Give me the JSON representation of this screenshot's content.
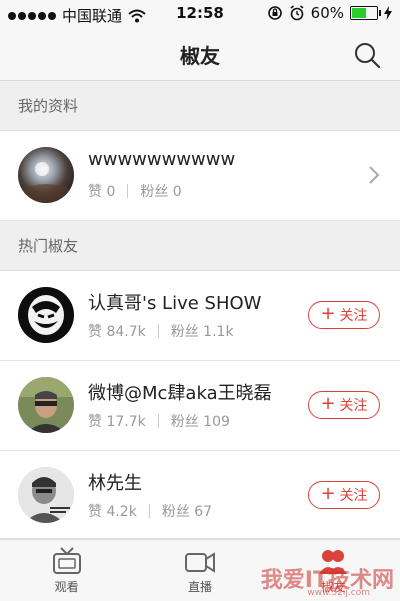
{
  "status_bar": {
    "carrier": "中国联通",
    "time": "12:58",
    "battery_percent": "60%",
    "battery_level": 0.6,
    "signal_bars": 5
  },
  "nav": {
    "title": "椒友",
    "search_icon": "search-icon"
  },
  "my_profile": {
    "section_title": "我的资料",
    "name": "wwwwwwwwww",
    "likes": "赞 0",
    "fans": "粉丝 0"
  },
  "hot_friends": {
    "section_title": "热门椒友",
    "follow_label": "关注",
    "items": [
      {
        "name": "认真哥's Live SHOW",
        "likes": "赞 84.7k",
        "fans": "粉丝 1.1k"
      },
      {
        "name": "微博@Mc肆aka王晓磊",
        "likes": "赞 17.7k",
        "fans": "粉丝 109"
      },
      {
        "name": "林先生",
        "likes": "赞 4.2k",
        "fans": "粉丝 67"
      }
    ]
  },
  "tabs": [
    {
      "label": "观看",
      "icon": "tv-icon"
    },
    {
      "label": "直播",
      "icon": "camera-icon"
    },
    {
      "label": "椒友",
      "icon": "friends-icon",
      "active": true
    }
  ],
  "watermark": {
    "text": "我爱IT技术网",
    "url": "www.52ij.com"
  },
  "colors": {
    "accent": "#d9433a",
    "battery_green": "#2bcc2b"
  }
}
